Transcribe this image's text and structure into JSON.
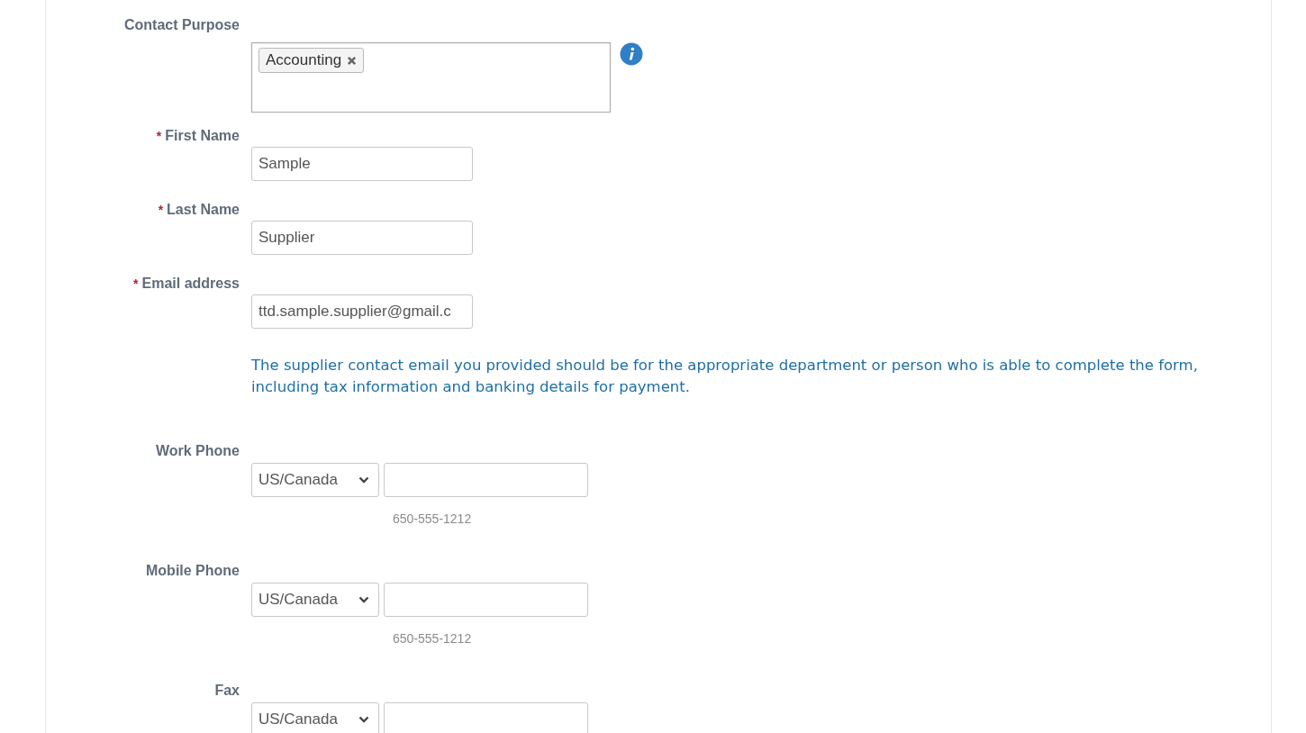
{
  "fields": [
    {
      "kind": "tags",
      "label": "Contact Purpose",
      "tags": [
        {
          "text": "Accounting"
        }
      ]
    },
    {
      "kind": "text",
      "required_mark": "*",
      "label": "First Name",
      "value": "Sample"
    },
    {
      "kind": "text",
      "required_mark": "*",
      "label": "Last Name",
      "value": "Supplier"
    },
    {
      "kind": "text",
      "required_mark": "*",
      "label": "Email address",
      "value": "ttd.sample.supplier@gmail.c"
    },
    {
      "kind": "note",
      "text": "The supplier contact email you provided should be for the appropriate department or person who is able to complete the form, including tax information and banking details for payment."
    },
    {
      "kind": "phone",
      "label": "Work Phone",
      "country": "US/Canada",
      "hint": "650-555-1212"
    },
    {
      "kind": "phone",
      "label": "Mobile Phone",
      "country": "US/Canada",
      "hint": "650-555-1212"
    },
    {
      "kind": "phone",
      "label": "Fax",
      "country": "US/Canada"
    }
  ]
}
